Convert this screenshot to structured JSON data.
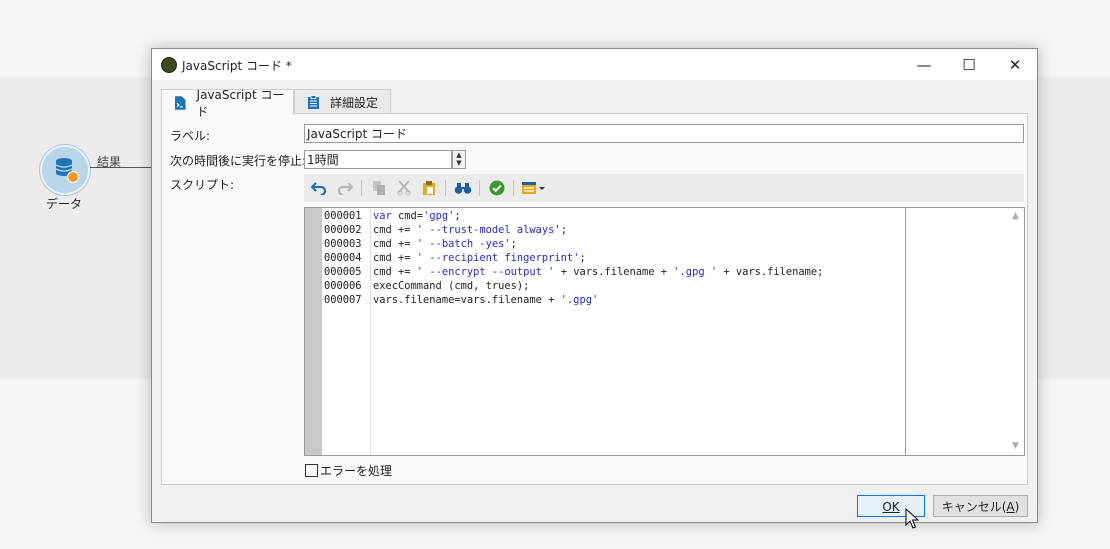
{
  "canvas": {
    "node_label": "データ",
    "edge_label": "結果"
  },
  "dialog": {
    "title": "JavaScript コード *",
    "window_controls": {
      "minimize": "—",
      "maximize": "☐",
      "close": "✕"
    },
    "tabs": [
      {
        "label": "JavaScript コード",
        "icon": "script-file-icon",
        "active": true
      },
      {
        "label": "詳細設定",
        "icon": "settings-list-icon",
        "active": false
      }
    ],
    "fields": {
      "label_label": "ラベル:",
      "label_value": "JavaScript コード",
      "timeout_label": "次の時間後に実行を停止:",
      "timeout_value": "1時間",
      "script_label": "スクリプト:"
    },
    "toolbar": [
      "undo-icon",
      "redo-icon",
      "copy-icon",
      "cut-icon",
      "paste-icon",
      "find-icon",
      "check-syntax-icon",
      "insert-menu-icon"
    ],
    "code": {
      "line_numbers": [
        "000001",
        "000002",
        "000003",
        "000004",
        "000005",
        "000006",
        "000007"
      ]
    },
    "error_checkbox_label": "エラーを処理",
    "buttons": {
      "ok": "OK",
      "ok_accel": "O",
      "cancel": "キャンセル(",
      "cancel_accel": "A",
      "cancel_end": ")"
    }
  }
}
